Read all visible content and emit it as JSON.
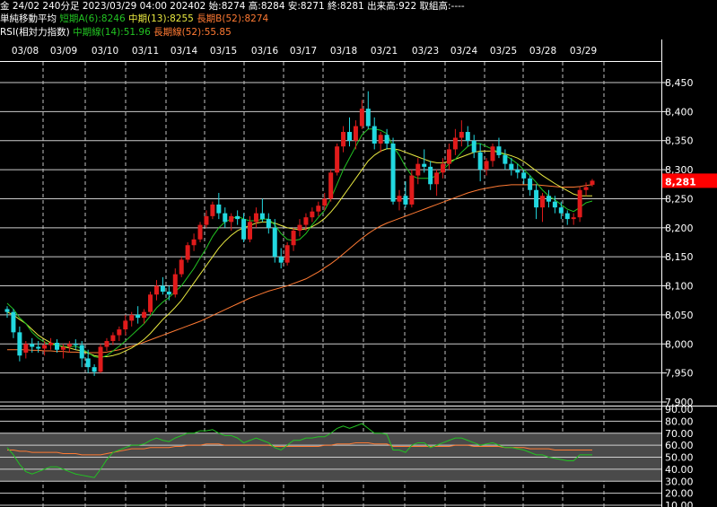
{
  "header": {
    "line1": {
      "info": "金 24/02 240分足 2023/03/29 04:00 202402 始:8274 高:8284 安:8271 終:8281 出来高:922 取組高:----",
      "ma_title": "単純移動平均",
      "ma_short": "短期A(6):8246",
      "ma_mid": "中期(13):8255",
      "ma_long": "長期B(52):8274"
    },
    "line2": {
      "rsi_title": "RSI(相対力指数)",
      "rsi_mid": "中期線(14):51.96",
      "rsi_long": "長期線(52):55.85"
    }
  },
  "colors": {
    "background": "#000000",
    "up_candle": "#e01b1b",
    "down_candle": "#22d8e0",
    "ma_short": "#22c322",
    "ma_mid": "#e8e840",
    "ma_long": "#ff7a33",
    "rsi_mid": "#22c322",
    "rsi_long": "#ff7a33",
    "price_tag": "#ff0000"
  },
  "chart_data": {
    "type": "candlestick",
    "dates": [
      "03/08",
      "03/09",
      "03/10",
      "03/11",
      "03/14",
      "03/15",
      "03/16",
      "03/17",
      "03/18",
      "03/21",
      "03/23",
      "03/24",
      "03/25",
      "03/28",
      "03/29"
    ],
    "price_axis": {
      "min": 7900,
      "max": 8450,
      "ticks": [
        "8,450",
        "8,400",
        "8,350",
        "8,300",
        "8,250",
        "8,200",
        "8,150",
        "8,100",
        "8,050",
        "8,000",
        "7,950",
        "7,900"
      ]
    },
    "current_price": "8,281",
    "candles": [
      [
        8060,
        8065,
        8045,
        8055
      ],
      [
        8055,
        8060,
        8010,
        8020
      ],
      [
        8020,
        8030,
        7970,
        7980
      ],
      [
        7985,
        8005,
        7975,
        8000
      ],
      [
        8000,
        8010,
        7985,
        7995
      ],
      [
        7995,
        8005,
        7985,
        7992
      ],
      [
        7992,
        8005,
        7980,
        7998
      ],
      [
        7998,
        8010,
        7990,
        8002
      ],
      [
        8002,
        8008,
        7985,
        7990
      ],
      [
        7990,
        8000,
        7975,
        7995
      ],
      [
        7995,
        8005,
        7985,
        8000
      ],
      [
        8000,
        8008,
        7990,
        7998
      ],
      [
        7998,
        8005,
        7960,
        7975
      ],
      [
        7975,
        7990,
        7950,
        7960
      ],
      [
        7960,
        7965,
        7945,
        7952
      ],
      [
        7952,
        8000,
        7950,
        7995
      ],
      [
        7995,
        8010,
        7988,
        8005
      ],
      [
        8005,
        8020,
        7998,
        8015
      ],
      [
        8015,
        8030,
        8005,
        8025
      ],
      [
        8025,
        8050,
        8015,
        8040
      ],
      [
        8040,
        8055,
        8030,
        8050
      ],
      [
        8050,
        8065,
        8035,
        8045
      ],
      [
        8045,
        8060,
        8035,
        8055
      ],
      [
        8055,
        8090,
        8050,
        8085
      ],
      [
        8085,
        8110,
        8075,
        8100
      ],
      [
        8100,
        8115,
        8085,
        8090
      ],
      [
        8090,
        8100,
        8075,
        8085
      ],
      [
        8085,
        8130,
        8080,
        8120
      ],
      [
        8120,
        8150,
        8115,
        8145
      ],
      [
        8145,
        8175,
        8140,
        8170
      ],
      [
        8170,
        8190,
        8160,
        8180
      ],
      [
        8180,
        8210,
        8175,
        8205
      ],
      [
        8205,
        8230,
        8200,
        8220
      ],
      [
        8220,
        8245,
        8215,
        8240
      ],
      [
        8240,
        8260,
        8215,
        8225
      ],
      [
        8225,
        8235,
        8200,
        8210
      ],
      [
        8210,
        8225,
        8195,
        8220
      ],
      [
        8220,
        8230,
        8205,
        8215
      ],
      [
        8215,
        8225,
        8175,
        8180
      ],
      [
        8180,
        8220,
        8175,
        8210
      ],
      [
        8210,
        8235,
        8200,
        8225
      ],
      [
        8225,
        8250,
        8210,
        8215
      ],
      [
        8215,
        8225,
        8190,
        8200
      ],
      [
        8200,
        8215,
        8140,
        8150
      ],
      [
        8150,
        8165,
        8130,
        8140
      ],
      [
        8140,
        8175,
        8135,
        8170
      ],
      [
        8170,
        8200,
        8160,
        8195
      ],
      [
        8195,
        8215,
        8185,
        8205
      ],
      [
        8205,
        8225,
        8195,
        8218
      ],
      [
        8218,
        8235,
        8210,
        8228
      ],
      [
        8228,
        8245,
        8220,
        8238
      ],
      [
        8238,
        8260,
        8230,
        8250
      ],
      [
        8250,
        8300,
        8245,
        8295
      ],
      [
        8295,
        8345,
        8290,
        8340
      ],
      [
        8340,
        8375,
        8330,
        8365
      ],
      [
        8365,
        8390,
        8340,
        8350
      ],
      [
        8350,
        8385,
        8335,
        8375
      ],
      [
        8375,
        8420,
        8370,
        8405
      ],
      [
        8405,
        8435,
        8370,
        8375
      ],
      [
        8375,
        8390,
        8335,
        8345
      ],
      [
        8345,
        8365,
        8330,
        8360
      ],
      [
        8360,
        8370,
        8335,
        8345
      ],
      [
        8345,
        8355,
        8240,
        8245
      ],
      [
        8245,
        8265,
        8230,
        8255
      ],
      [
        8255,
        8280,
        8235,
        8240
      ],
      [
        8240,
        8300,
        8235,
        8290
      ],
      [
        8290,
        8320,
        8275,
        8310
      ],
      [
        8310,
        8335,
        8295,
        8305
      ],
      [
        8305,
        8315,
        8265,
        8275
      ],
      [
        8275,
        8300,
        8255,
        8295
      ],
      [
        8295,
        8320,
        8285,
        8310
      ],
      [
        8310,
        8345,
        8300,
        8335
      ],
      [
        8335,
        8370,
        8325,
        8355
      ],
      [
        8355,
        8385,
        8340,
        8365
      ],
      [
        8365,
        8375,
        8340,
        8350
      ],
      [
        8350,
        8360,
        8320,
        8330
      ],
      [
        8330,
        8345,
        8280,
        8300
      ],
      [
        8300,
        8320,
        8290,
        8315
      ],
      [
        8315,
        8345,
        8305,
        8340
      ],
      [
        8340,
        8355,
        8320,
        8325
      ],
      [
        8325,
        8335,
        8300,
        8310
      ],
      [
        8310,
        8320,
        8290,
        8300
      ],
      [
        8300,
        8310,
        8285,
        8295
      ],
      [
        8295,
        8300,
        8275,
        8285
      ],
      [
        8285,
        8290,
        8255,
        8265
      ],
      [
        8265,
        8275,
        8215,
        8235
      ],
      [
        8235,
        8260,
        8210,
        8255
      ],
      [
        8255,
        8265,
        8235,
        8245
      ],
      [
        8245,
        8255,
        8225,
        8235
      ],
      [
        8235,
        8245,
        8215,
        8225
      ],
      [
        8225,
        8230,
        8205,
        8215
      ],
      [
        8215,
        8225,
        8205,
        8218
      ],
      [
        8218,
        8270,
        8210,
        8265
      ],
      [
        8265,
        8278,
        8255,
        8270
      ],
      [
        8274,
        8284,
        8271,
        8281
      ]
    ],
    "ma_short": [
      8070,
      8060,
      8045,
      8035,
      8020,
      8010,
      8003,
      7999,
      7998,
      7996,
      7995,
      7996,
      7992,
      7985,
      7978,
      7976,
      7980,
      7988,
      7996,
      8005,
      8015,
      8025,
      8035,
      8048,
      8062,
      8072,
      8080,
      8090,
      8100,
      8115,
      8130,
      8148,
      8165,
      8185,
      8200,
      8210,
      8215,
      8220,
      8215,
      8212,
      8212,
      8215,
      8215,
      8205,
      8190,
      8180,
      8178,
      8180,
      8190,
      8205,
      8218,
      8230,
      8250,
      8275,
      8300,
      8320,
      8340,
      8360,
      8370,
      8370,
      8368,
      8362,
      8340,
      8325,
      8305,
      8290,
      8285,
      8285,
      8285,
      8290,
      8300,
      8310,
      8318,
      8330,
      8340,
      8345,
      8345,
      8340,
      8335,
      8330,
      8325,
      8318,
      8310,
      8300,
      8290,
      8278,
      8265,
      8255,
      8248,
      8240,
      8232,
      8228,
      8235,
      8243,
      8246
    ],
    "ma_mid": [
      8055,
      8050,
      8042,
      8035,
      8025,
      8015,
      8008,
      8002,
      7998,
      7995,
      7993,
      7990,
      7988,
      7984,
      7980,
      7978,
      7978,
      7980,
      7983,
      7988,
      7993,
      8000,
      8008,
      8018,
      8030,
      8042,
      8052,
      8063,
      8075,
      8090,
      8105,
      8120,
      8135,
      8150,
      8165,
      8177,
      8187,
      8195,
      8200,
      8204,
      8208,
      8210,
      8210,
      8208,
      8204,
      8200,
      8198,
      8197,
      8198,
      8202,
      8208,
      8216,
      8227,
      8240,
      8255,
      8270,
      8285,
      8300,
      8315,
      8325,
      8332,
      8336,
      8336,
      8334,
      8330,
      8326,
      8322,
      8318,
      8314,
      8312,
      8312,
      8314,
      8318,
      8322,
      8326,
      8330,
      8332,
      8332,
      8332,
      8330,
      8327,
      8324,
      8320,
      8314,
      8306,
      8298,
      8290,
      8283,
      8276,
      8270,
      8264,
      8258,
      8255,
      8255,
      8255
    ],
    "ma_long": [
      7990,
      7990,
      7990,
      7990,
      7989,
      7989,
      7988,
      7988,
      7987,
      7987,
      7986,
      7986,
      7985,
      7985,
      7985,
      7985,
      7986,
      7988,
      7990,
      7993,
      7996,
      7999,
      8003,
      8007,
      8011,
      8015,
      8019,
      8023,
      8027,
      8031,
      8035,
      8039,
      8044,
      8049,
      8054,
      8059,
      8064,
      8069,
      8074,
      8079,
      8083,
      8087,
      8091,
      8094,
      8097,
      8100,
      8104,
      8108,
      8112,
      8118,
      8124,
      8131,
      8138,
      8146,
      8155,
      8164,
      8173,
      8182,
      8190,
      8197,
      8203,
      8208,
      8212,
      8216,
      8220,
      8224,
      8228,
      8232,
      8236,
      8240,
      8244,
      8248,
      8252,
      8256,
      8260,
      8263,
      8266,
      8268,
      8270,
      8272,
      8273,
      8274,
      8274,
      8274,
      8274,
      8274,
      8273,
      8272,
      8271,
      8270,
      8270,
      8270,
      8271,
      8273,
      8274
    ],
    "rsi_axis": {
      "min": 10,
      "max": 90,
      "ticks": [
        "90.00",
        "80.00",
        "70.00",
        "60.00",
        "50.00",
        "40.00",
        "30.00",
        "20.00",
        "10.00"
      ]
    },
    "rsi_mid": [
      58,
      52,
      44,
      38,
      36,
      38,
      40,
      42,
      42,
      40,
      38,
      36,
      35,
      34,
      33,
      40,
      48,
      54,
      56,
      58,
      60,
      60,
      61,
      64,
      66,
      64,
      63,
      66,
      68,
      70,
      70,
      72,
      72,
      73,
      70,
      68,
      68,
      66,
      62,
      64,
      66,
      64,
      62,
      58,
      56,
      60,
      64,
      64,
      66,
      66,
      67,
      67,
      70,
      74,
      76,
      74,
      76,
      78,
      74,
      70,
      70,
      69,
      56,
      56,
      54,
      60,
      62,
      62,
      58,
      60,
      62,
      64,
      66,
      66,
      64,
      62,
      60,
      61,
      62,
      60,
      58,
      58,
      57,
      56,
      54,
      52,
      52,
      50,
      49,
      48,
      47,
      47,
      52,
      52,
      52
    ],
    "rsi_long": [
      56,
      56,
      55,
      55,
      54,
      54,
      54,
      54,
      54,
      53,
      53,
      53,
      52,
      52,
      52,
      52,
      53,
      54,
      55,
      56,
      57,
      57,
      57,
      58,
      58,
      58,
      58,
      59,
      59,
      60,
      60,
      60,
      61,
      61,
      61,
      60,
      60,
      60,
      60,
      60,
      60,
      60,
      60,
      59,
      59,
      59,
      59,
      59,
      59,
      59,
      59,
      60,
      60,
      61,
      61,
      61,
      62,
      62,
      62,
      61,
      61,
      61,
      59,
      59,
      59,
      59,
      59,
      59,
      59,
      59,
      59,
      59,
      60,
      60,
      60,
      59,
      59,
      59,
      59,
      59,
      58,
      58,
      58,
      58,
      57,
      57,
      57,
      57,
      56,
      56,
      56,
      56,
      56,
      56,
      56
    ]
  }
}
